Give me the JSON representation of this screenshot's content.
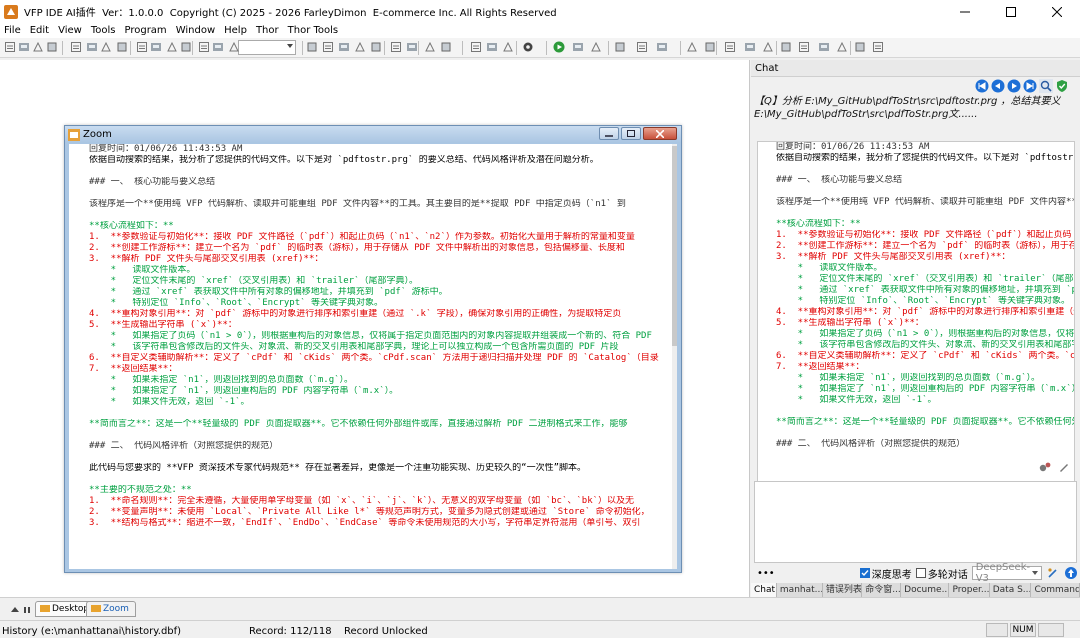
{
  "app": {
    "title": "VFP IDE AI插件  Ver：1.0.0.0  Copyright (C) 2025 - 2026 FarleyDimon  E-commerce Inc. All Rights Reserved"
  },
  "menu": [
    "File",
    "Edit",
    "View",
    "Tools",
    "Program",
    "Window",
    "Help",
    "Thor",
    "Thor Tools"
  ],
  "zoom_window": {
    "title": "Zoom"
  },
  "code_lines": [
    {
      "c": "gry",
      "t": "回复时间：01/06/26 11:43:53 AM"
    },
    {
      "c": "blk",
      "t": "依据自动搜索的结果，我分析了您提供的代码文件。以下是对 `pdftostr.prg` 的要义总结、代码风格评析及潜在问题分析。"
    },
    {
      "c": "blk",
      "t": ""
    },
    {
      "c": "gry",
      "t": "### 一、 核心功能与要义总结"
    },
    {
      "c": "blk",
      "t": ""
    },
    {
      "c": "gry",
      "t": "该程序是一个**使用纯 VFP 代码解析、读取并可能重组 PDF 文件内容**的工具。其主要目的是**提取 PDF 中指定页码（`n1` 到"
    },
    {
      "c": "blk",
      "t": ""
    },
    {
      "c": "grn",
      "t": "**核心流程如下：**"
    },
    {
      "c": "red",
      "t": "1.  **参数验证与初始化**：接收 PDF 文件路径（`pdf`）和起止页码（`n1`、`n2`）作为参数。初始化大量用于解析的常量和变量"
    },
    {
      "c": "red",
      "t": "2.  **创建工作游标**：建立一个名为 `pdf` 的临时表（游标），用于存储从 PDF 文件中解析出的对象信息，包括偏移量、长度和"
    },
    {
      "c": "red",
      "t": "3.  **解析 PDF 文件头与尾部交叉引用表 (xref)**："
    },
    {
      "c": "grn",
      "t": "    *   读取文件版本。"
    },
    {
      "c": "grn",
      "t": "    *   定位文件末尾的 `xref`（交叉引用表）和 `trailer`（尾部字典）。"
    },
    {
      "c": "grn",
      "t": "    *   通过 `xref` 表获取文件中所有对象的偏移地址，并填充到 `pdf` 游标中。"
    },
    {
      "c": "grn",
      "t": "    *   特别定位 `Info`、`Root`、`Encrypt` 等关键字典对象。"
    },
    {
      "c": "red",
      "t": "4.  **重构对象引用**：对 `pdf` 游标中的对象进行排序和索引重建（通过 `.k` 字段），确保对象引用的正确性，为提取特定页"
    },
    {
      "c": "red",
      "t": "5.  **生成输出字符串 (`x`)**："
    },
    {
      "c": "grn",
      "t": "    *   如果指定了页码（`n1 > 0`），则根据重构后的对象信息，仅将属于指定页面范围内的对象内容提取并组装成一个新的、符合 PDF"
    },
    {
      "c": "grn",
      "t": "    *   该字符串包含修改后的文件头、对象流、新的交叉引用表和尾部字典，理论上可以独立构成一个包含所需页面的 PDF 片段"
    },
    {
      "c": "red",
      "t": "6.  **自定义类辅助解析**：定义了 `cPdf` 和 `cKids` 两个类。`cPdf.scan` 方法用于递归扫描并处理 PDF 的 `Catalog`（目录"
    },
    {
      "c": "red",
      "t": "7.  **返回结果**："
    },
    {
      "c": "grn",
      "t": "    *   如果未指定 `n1`，则返回找到的总页面数（`m.g`）。"
    },
    {
      "c": "grn",
      "t": "    *   如果指定了 `n1`，则返回重构后的 PDF 内容字符串（`m.x`）。"
    },
    {
      "c": "grn",
      "t": "    *   如果文件无效，返回 `-1`。"
    },
    {
      "c": "blk",
      "t": ""
    },
    {
      "c": "grn",
      "t": "**简而言之**：这是一个**轻量级的 PDF 页面提取器**。它不依赖任何外部组件或库，直接通过解析 PDF 二进制格式来工作，能够"
    },
    {
      "c": "blk",
      "t": ""
    },
    {
      "c": "gry",
      "t": "### 二、 代码风格评析（对照您提供的规范）"
    },
    {
      "c": "blk",
      "t": ""
    },
    {
      "c": "blk",
      "t": "此代码与您要求的 **VFP 资深技术专家代码规范** 存在显著差异，更像是一个注重功能实现、历史较久的“一次性”脚本。"
    },
    {
      "c": "blk",
      "t": ""
    },
    {
      "c": "grn",
      "t": "**主要的不规范之处：**"
    },
    {
      "c": "red",
      "t": "1.  **命名规则**：完全未遵循，大量使用单字母变量（如 `x`、`i`、`j`、`k`）、无意义的双字母变量（如 `bc`、`bk`）以及无"
    },
    {
      "c": "red",
      "t": "2.  **变量声明**：未使用 `Local`、`Private All Like l*` 等规范声明方式，变量多为隐式创建或通过 `Store` 命令初始化，"
    },
    {
      "c": "red",
      "t": "3.  **结构与格式**：缩进不一致，`EndIf`、`EndDo`、`EndCase` 等命令未使用规范的大小写，字符串定界符混用（单引号、双引"
    }
  ],
  "chat_panel": {
    "header": "Chat",
    "summary": "【Q】分析  E:\\My_GitHub\\pdfToStr\\src\\pdftostr.prg ，总结其要义  E:\\My_GitHub\\pdfToStr\\src\\pdfToStr.prg文......",
    "deep_think_label": "深度思考",
    "multi_turn_label": "多轮对话",
    "model": "DeepSeek-V3",
    "dots": "•••",
    "tabs": [
      "Chat",
      "manhat...",
      "错误列表",
      "命令窗...",
      "Docume...",
      "Proper...",
      "Data S...",
      "Command"
    ]
  },
  "bottom_tabs": {
    "desktop": "Desktop",
    "zoom": "Zoom"
  },
  "status": {
    "history": "History (e:\\manhattanai\\history.dbf)",
    "record": "Record: 112/118",
    "lock": "Record Unlocked",
    "num": "NUM"
  },
  "colors": {
    "accent": "#1a6fd0",
    "green_text": "#00a040",
    "red_text": "#e00000"
  }
}
